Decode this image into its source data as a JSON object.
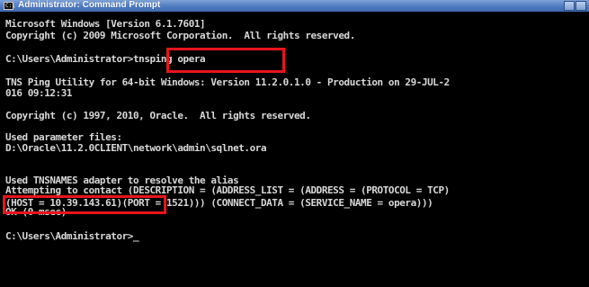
{
  "window": {
    "title": "Administrator: Command Prompt",
    "icon_label": "C:\\"
  },
  "console": {
    "lines": [
      "Microsoft Windows [Version 6.1.7601]",
      "Copyright (c) 2009 Microsoft Corporation.  All rights reserved.",
      "",
      "C:\\Users\\Administrator>tnsping opera",
      "",
      "TNS Ping Utility for 64-bit Windows: Version 11.2.0.1.0 - Production on 29-JUL-2",
      "016 09:12:31",
      "",
      "Copyright (c) 1997, 2010, Oracle.  All rights reserved.",
      "",
      "Used parameter files:",
      "D:\\Oracle\\11.2.0CLIENT\\network\\admin\\sqlnet.ora",
      "",
      "",
      "Used TNSNAMES adapter to resolve the alias",
      "Attempting to contact (DESCRIPTION = (ADDRESS_LIST = (ADDRESS = (PROTOCOL = TCP)",
      "(HOST = 10.39.143.61)(PORT = 1521))) (CONNECT_DATA = (SERVICE_NAME = opera)))",
      "OK (0 msec)",
      "",
      "C:\\Users\\Administrator>_"
    ]
  },
  "annotations": {
    "highlight_color": "#e8141c",
    "highlights": [
      {
        "name": "command-highlight",
        "text": "tnsping opera"
      },
      {
        "name": "host-highlight",
        "text": "(HOST = 10.39.143.61)"
      }
    ]
  },
  "colors": {
    "background": "#000000",
    "foreground": "#d8d8d8",
    "titlebar": "#4f7bc1"
  }
}
